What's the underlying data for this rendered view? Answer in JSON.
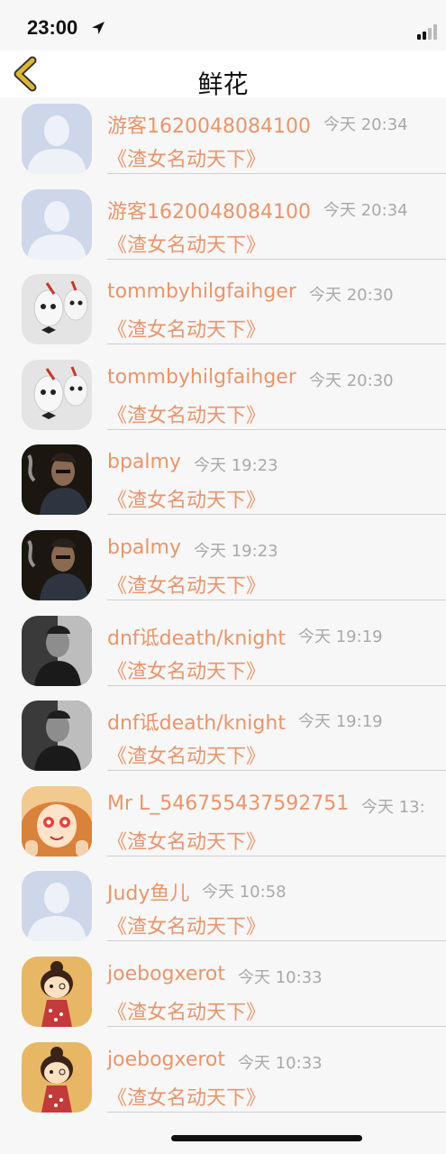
{
  "status_bar": {
    "time": "23:00"
  },
  "nav": {
    "title": "鲜花"
  },
  "colors": {
    "accent": "#e8956b",
    "timestamp": "#a9a9a9",
    "back_arrow": "#ddb734"
  },
  "rows": [
    {
      "username": "游客1620048084100",
      "time": "今天 20:34",
      "message": "《渣女名动天下》",
      "avatar": "placeholder-avatar-icon"
    },
    {
      "username": "游客1620048084100",
      "time": "今天 20:34",
      "message": "《渣女名动天下》",
      "avatar": "placeholder-avatar-icon"
    },
    {
      "username": "tommbyhilgfaihger",
      "time": "今天 20:30",
      "message": "《渣女名动天下》",
      "avatar": "egg-figures-avatar"
    },
    {
      "username": "tommbyhilgfaihger",
      "time": "今天 20:30",
      "message": "《渣女名动天下》",
      "avatar": "egg-figures-avatar"
    },
    {
      "username": "bpalmy",
      "time": "今天 19:23",
      "message": "《渣女名动天下》",
      "avatar": "smoking-man-avatar"
    },
    {
      "username": "bpalmy",
      "time": "今天 19:23",
      "message": "《渣女名动天下》",
      "avatar": "smoking-man-avatar"
    },
    {
      "username": "dnf诋death/knight",
      "time": "今天 19:19",
      "message": "《渣女名动天下》",
      "avatar": "man-portrait-avatar"
    },
    {
      "username": "dnf诋death/knight",
      "time": "今天 19:19",
      "message": "《渣女名动天下》",
      "avatar": "man-portrait-avatar"
    },
    {
      "username": "Mr L_546755437592751",
      "time": "今天 13:",
      "message": "《渣女名动天下》",
      "avatar": "cartoon-girl-avatar"
    },
    {
      "username": "Judy鱼儿",
      "time": "今天 10:58",
      "message": "《渣女名动天下》",
      "avatar": "placeholder-avatar-icon"
    },
    {
      "username": "joebogxerot",
      "time": "今天 10:33",
      "message": "《渣女名动天下》",
      "avatar": "cartoon-doll-avatar"
    },
    {
      "username": "joebogxerot",
      "time": "今天 10:33",
      "message": "《渣女名动天下》",
      "avatar": "cartoon-doll-avatar"
    }
  ]
}
